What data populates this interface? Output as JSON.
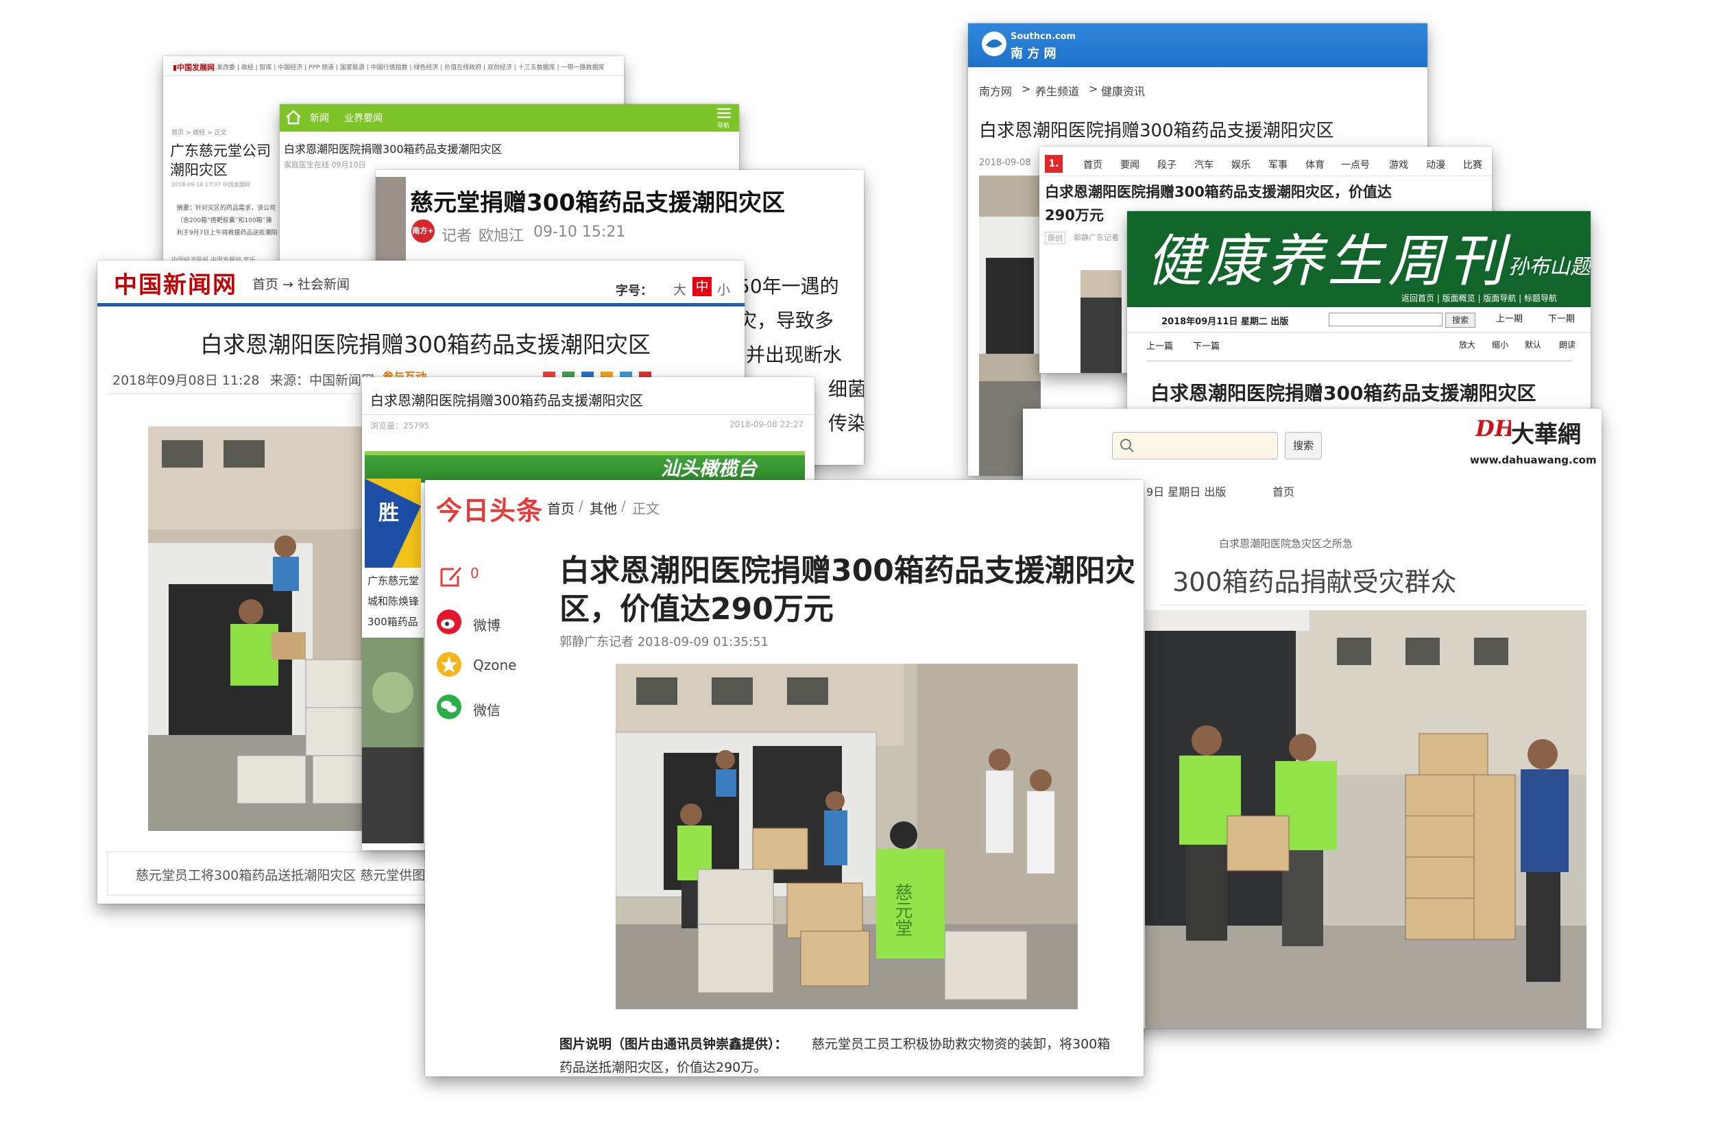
{
  "colors": {
    "cn_news_red": "#c00000",
    "cn_news_blue": "#1f5fae",
    "southcn_blue": "#1d72c9",
    "toutiao_red": "#e93a3a",
    "green_bar": "#7cc428",
    "health_green": "#12652a",
    "vest_green": "#9be64a"
  },
  "card_cnfb": {
    "nav": "发改委 | 政经 | 智库 | 中国经济 | PPP 频道 | 国家能源 | 中国行情指数 | 绿色经济 | 价值在线政府 | 双创经济 | 十三五数据库 | 一带一路数据库",
    "crumb": "首页 > 政经 > 正文",
    "title_line1": "广东慈元堂公司",
    "title_line2": "潮阳灾区",
    "meta": "2018-09-10 17:37 中国发展网",
    "body1": "摘要：针对灾区的药品需求，该公司",
    "body2": "（含200箱“癌靶胶囊”和100箱“蒲",
    "body3": "利于9月7日上午将救援药品送抵潮阳",
    "footer": "中国经济导报 中国发展网 李乐"
  },
  "card_yiyuan": {
    "tab1": "新闻",
    "tab2": "业界要闻",
    "nav_label": "导航",
    "title": "白求恩潮阳医院捐赠300箱药品支援潮阳灾区",
    "meta": "家庭医生在线 09月10日"
  },
  "card_ciyuantang": {
    "title": "慈元堂捐赠300箱药品支援潮阳灾区",
    "author_prefix": "记者",
    "author": "欧旭江",
    "time": "09-10 15:21",
    "badge": "南方+",
    "body": [
      "50年一遇的",
      "灾，导致多",
      "并出现断水",
      "细菌",
      "传染"
    ]
  },
  "card_chinanews": {
    "logo": "中国新闻网",
    "crumb": "首页 → 社会新闻",
    "font_label": "字号：",
    "font_big": "大",
    "font_mid": "中",
    "font_small": "小",
    "title": "白求恩潮阳医院捐赠300箱药品支援潮阳灾区",
    "date": "2018年09月08日 11:28",
    "source": "来源：中国新闻网",
    "interact": "参与互动",
    "caption": "慈元堂员工将300箱药品送抵潮阳灾区 慈元堂供图"
  },
  "card_shantou": {
    "title": "白求恩潮阳医院捐赠300箱药品支援潮阳灾区",
    "views": "浏览量：25795",
    "date": "2018-09-08 22:27",
    "banner": "汕头橄榄台",
    "sub1": "广东慈元堂",
    "sub2": "城和陈焕锋",
    "sub3": "300箱药品"
  },
  "card_southcn": {
    "logo_en": "Southcn.com",
    "logo_cn": "南 方 网",
    "crumb": [
      "南方网",
      "养生频道",
      "健康资讯"
    ],
    "title": "白求恩潮阳医院捐赠300箱药品支援潮阳灾区",
    "date": "2018-09-08"
  },
  "card_dayoo": {
    "logo": "1.",
    "nav": [
      "首页",
      "要闻",
      "段子",
      "汽车",
      "娱乐",
      "军事",
      "体育",
      "一点号",
      "游戏",
      "动漫",
      "比赛"
    ],
    "title_line1": "白求恩潮阳医院捐赠300箱药品支援潮阳灾区，价值达",
    "title_line2": "290万元",
    "tag": "原创",
    "meta": "郭静广东记者"
  },
  "card_health": {
    "masthead": "健康养生周刊",
    "signature": "孙布山题",
    "links": "返回首页 | 版面概览 | 版面导航 | 标题导航",
    "date": "2018年09月11日 星期二 出版",
    "search_btn": "搜索",
    "prev_issue": "上一期",
    "next_issue": "下一期",
    "prev_page": "上一篇",
    "next_page": "下一篇",
    "zoom": "放大",
    "shrink": "缩小",
    "default": "默认",
    "read": "朗读",
    "title": "白求恩潮阳医院捐赠300箱药品支援潮阳灾区"
  },
  "card_dahua": {
    "logo_cn": "大華網",
    "logo_en": "www.dahuawang.com",
    "search_btn": "搜索",
    "date_bit": "9日 星期日 出版",
    "home": "首页",
    "subtitle": "白求恩潮阳医院急灾区之所急",
    "headline": "300箱药品捐献受灾群众"
  },
  "card_toutiao": {
    "logo": "今日头条",
    "crumb_home": "首页",
    "crumb_other": "其他",
    "crumb_body": "正文",
    "comments": "0",
    "share_weibo": "微博",
    "share_qzone": "Qzone",
    "share_wechat": "微信",
    "title_line1": "白求恩潮阳医院捐赠300箱药品支援潮阳灾",
    "title_line2": "区，价值达290万元",
    "meta": "郭静广东记者  2018-09-09 01:35:51",
    "caption_bold": "图片说明（图片由通讯员钟崇鑫提供）：",
    "caption_line1": "慈元堂员工员工积极协助救灾物资的装卸，将300箱",
    "caption_line2": "药品送抵潮阳灾区，价值达290万。",
    "vest_text": "慈元堂"
  }
}
